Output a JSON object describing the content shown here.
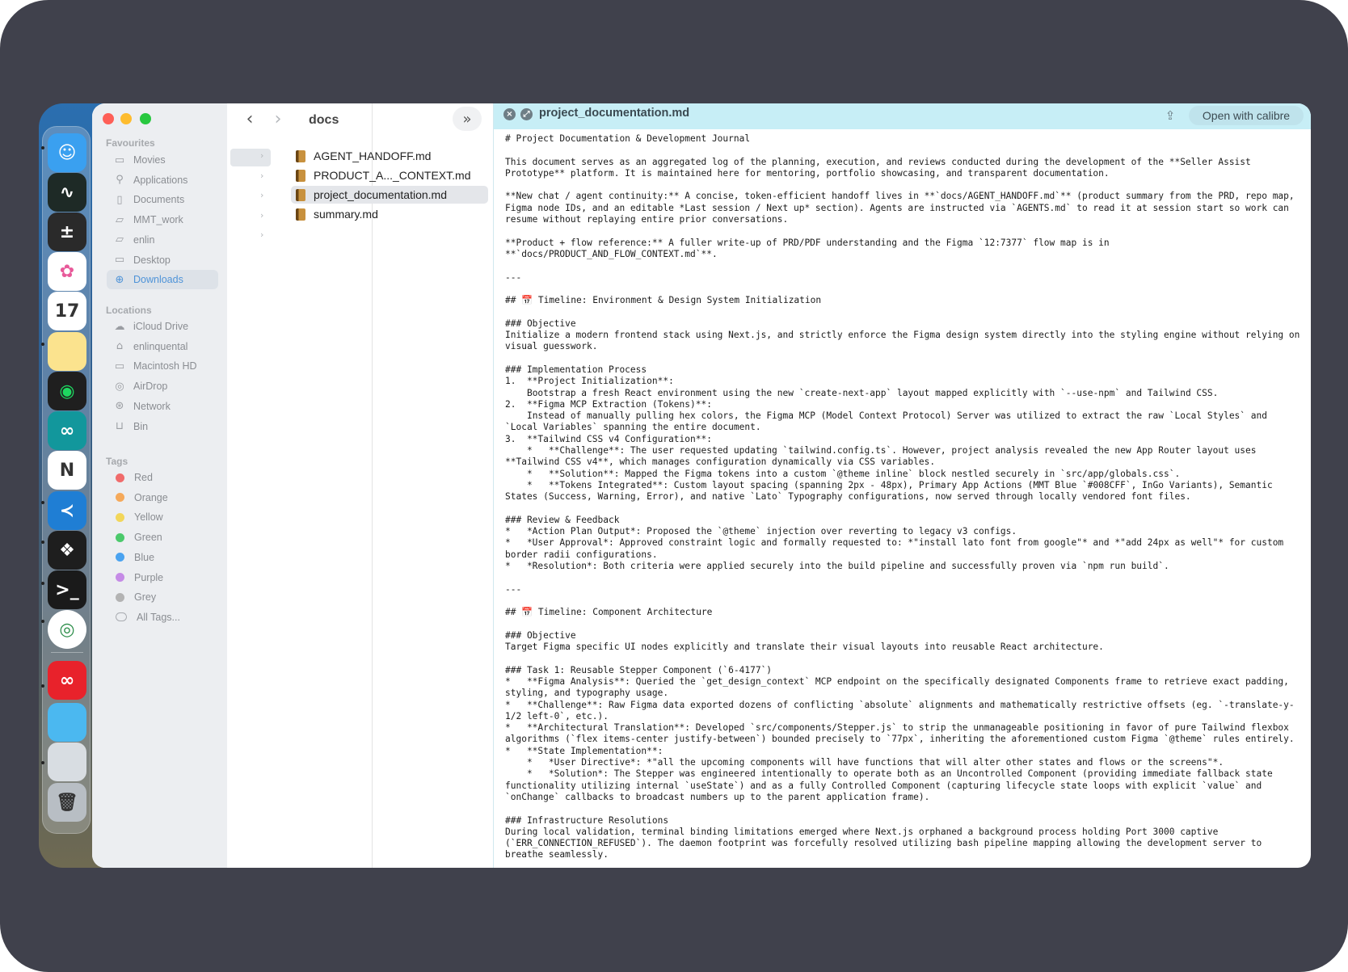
{
  "finder": {
    "path_title": "docs",
    "sidebar": {
      "favourites_heading": "Favourites",
      "favourites": [
        {
          "label": "Movies",
          "icon": "film-icon"
        },
        {
          "label": "Applications",
          "icon": "applications-icon"
        },
        {
          "label": "Documents",
          "icon": "document-icon"
        },
        {
          "label": "MMT_work",
          "icon": "folder-icon"
        },
        {
          "label": "enlin",
          "icon": "folder-icon"
        },
        {
          "label": "Desktop",
          "icon": "desktop-icon"
        },
        {
          "label": "Downloads",
          "icon": "download-icon",
          "active": true
        }
      ],
      "locations_heading": "Locations",
      "locations": [
        {
          "label": "iCloud Drive",
          "icon": "cloud-icon"
        },
        {
          "label": "enlinquental",
          "icon": "home-icon"
        },
        {
          "label": "Macintosh HD",
          "icon": "disk-icon"
        },
        {
          "label": "AirDrop",
          "icon": "airdrop-icon"
        },
        {
          "label": "Network",
          "icon": "globe-icon"
        },
        {
          "label": "Bin",
          "icon": "trash-icon"
        }
      ],
      "tags_heading": "Tags",
      "tags": [
        {
          "label": "Red",
          "color": "#f06b6b"
        },
        {
          "label": "Orange",
          "color": "#f5a95a"
        },
        {
          "label": "Yellow",
          "color": "#f2d65a"
        },
        {
          "label": "Green",
          "color": "#4bc96b"
        },
        {
          "label": "Blue",
          "color": "#4aa3f0"
        },
        {
          "label": "Purple",
          "color": "#c58be6"
        },
        {
          "label": "Grey",
          "color": "#b3b3b3"
        },
        {
          "label": "All Tags...",
          "color": ""
        }
      ]
    },
    "files": [
      {
        "name": "AGENT_HANDOFF.md"
      },
      {
        "name": "PRODUCT_A..._CONTEXT.md"
      },
      {
        "name": "project_documentation.md",
        "selected": true
      },
      {
        "name": "summary.md"
      }
    ]
  },
  "quicklook": {
    "filename": "project_documentation.md",
    "open_button": "Open with calibre",
    "content": "# Project Documentation & Development Journal\n\nThis document serves as an aggregated log of the planning, execution, and reviews conducted during the development of the **Seller Assist Prototype** platform. It is maintained here for mentoring, portfolio showcasing, and transparent documentation.\n\n**New chat / agent continuity:** A concise, token-efficient handoff lives in **`docs/AGENT_HANDOFF.md`** (product summary from the PRD, repo map, Figma node IDs, and an editable *Last session / Next up* section). Agents are instructed via `AGENTS.md` to read it at session start so work can resume without replaying entire prior conversations.\n\n**Product + flow reference:** A fuller write-up of PRD/PDF understanding and the Figma `12:7377` flow map is in **`docs/PRODUCT_AND_FLOW_CONTEXT.md`**.\n\n---\n\n## 📅 Timeline: Environment & Design System Initialization\n\n### Objective\nInitialize a modern frontend stack using Next.js, and strictly enforce the Figma design system directly into the styling engine without relying on visual guesswork.\n\n### Implementation Process\n1.  **Project Initialization**:\n    Bootstrap a fresh React environment using the new `create-next-app` layout mapped explicitly with `--use-npm` and Tailwind CSS.\n2.  **Figma MCP Extraction (Tokens)**:\n    Instead of manually pulling hex colors, the Figma MCP (Model Context Protocol) Server was utilized to extract the raw `Local Styles` and `Local Variables` spanning the entire document.\n3.  **Tailwind CSS v4 Configuration**:\n    *   **Challenge**: The user requested updating `tailwind.config.ts`. However, project analysis revealed the new App Router layout uses **Tailwind CSS v4**, which manages configuration dynamically via CSS variables.\n    *   **Solution**: Mapped the Figma tokens into a custom `@theme inline` block nestled securely in `src/app/globals.css`.\n    *   **Tokens Integrated**: Custom layout spacing (spanning 2px - 48px), Primary App Actions (MMT Blue `#008CFF`, InGo Variants), Semantic States (Success, Warning, Error), and native `Lato` Typography configurations, now served through locally vendored font files.\n\n### Review & Feedback\n*   *Action Plan Output*: Proposed the `@theme` injection over reverting to legacy v3 configs.\n*   *User Approval*: Approved constraint logic and formally requested to: *\"install lato font from google\"* and *\"add 24px as well\"* for custom border radii configurations.\n*   *Resolution*: Both criteria were applied securely into the build pipeline and successfully proven via `npm run build`.\n\n---\n\n## 📅 Timeline: Component Architecture\n\n### Objective\nTarget Figma specific UI nodes explicitly and translate their visual layouts into reusable React architecture.\n\n### Task 1: Reusable Stepper Component (`6-4177`)\n*   **Figma Analysis**: Queried the `get_design_context` MCP endpoint on the specifically designated Components frame to retrieve exact padding, styling, and typography usage.\n*   **Challenge**: Raw Figma data exported dozens of conflicting `absolute` alignments and mathematically restrictive offsets (eg. `-translate-y-1/2 left-0`, etc.).\n*   **Architectural Translation**: Developed `src/components/Stepper.js` to strip the unmanageable positioning in favor of pure Tailwind flexbox algorithms (`flex items-center justify-between`) bounded precisely to `77px`, inheriting the aforementioned custom Figma `@theme` rules entirely.\n*   **State Implementation**:\n    *   *User Directive*: *\"all the upcoming components will have functions that will alter other states and flows or the screens\"*.\n    *   *Solution*: The Stepper was engineered intentionally to operate both as an Uncontrolled Component (providing immediate fallback state functionality utilizing internal `useState`) and as a fully Controlled Component (capturing lifecycle state loops with explicit `value` and `onChange` callbacks to broadcast numbers up to the parent application frame).\n\n### Infrastructure Resolutions\nDuring local validation, terminal binding limitations emerged where Next.js orphaned a background process holding Port 3000 captive (`ERR_CONNECTION_REFUSED`). The daemon footprint was forcefully resolved utilizing bash pipeline mapping allowing the development server to breathe seamlessly."
  },
  "dock": {
    "items": [
      {
        "name": "finder-icon",
        "color": "#3aa0f0",
        "glyph": "☺"
      },
      {
        "name": "activity-monitor-icon",
        "color": "#1e2a26",
        "glyph": "∿"
      },
      {
        "name": "calculator-icon",
        "color": "#2a2a2a",
        "glyph": "±"
      },
      {
        "name": "photos-icon",
        "color": "#ffffff",
        "glyph": "✿"
      },
      {
        "name": "calendar-icon",
        "color": "#ffffff",
        "glyph": "17"
      },
      {
        "name": "notes-icon",
        "color": "#fbe38e",
        "glyph": ""
      },
      {
        "name": "spotify-icon",
        "color": "#1f1f1f",
        "glyph": "◉"
      },
      {
        "name": "arduino-icon",
        "color": "#12979c",
        "glyph": "∞"
      },
      {
        "name": "notion-icon",
        "color": "#ffffff",
        "glyph": "N"
      },
      {
        "name": "vscode-icon",
        "color": "#1f7ed4",
        "glyph": "≺"
      },
      {
        "name": "figma-icon",
        "color": "#1e1e1e",
        "glyph": "❖"
      },
      {
        "name": "terminal-icon",
        "color": "#1a1a1a",
        "glyph": ">_"
      },
      {
        "name": "chrome-icon",
        "color": "#ffffff",
        "glyph": "◎"
      },
      {
        "name": "creative-cloud-icon",
        "color": "#e8222b",
        "glyph": "∞"
      },
      {
        "name": "downloads-folder-icon",
        "color": "#4bb8f0",
        "glyph": ""
      },
      {
        "name": "preview-thumbnail-icon",
        "color": "#d8dde2",
        "glyph": ""
      },
      {
        "name": "trash-icon",
        "color": "#b8bec4",
        "glyph": "🗑"
      }
    ]
  }
}
